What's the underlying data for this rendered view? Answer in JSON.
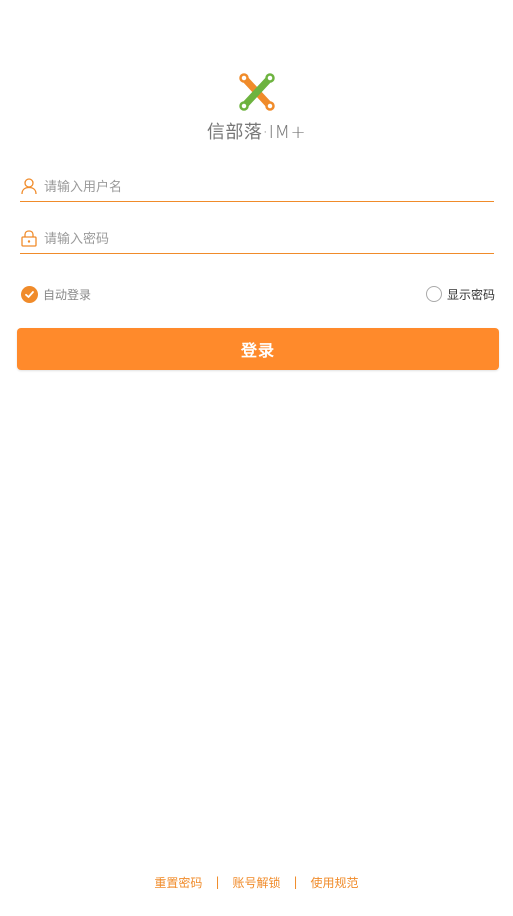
{
  "logo": {
    "name": "信部落·IM+",
    "colors": {
      "orange": "#f08b2a",
      "green": "#6db33f"
    }
  },
  "login_form": {
    "username": {
      "placeholder": "请输入用户名",
      "value": "",
      "icon": "user-icon"
    },
    "password": {
      "placeholder": "请输入密码",
      "value": "",
      "icon": "lock-icon"
    },
    "auto_login": {
      "label": "自动登录",
      "checked": true
    },
    "show_password": {
      "label": "显示密码",
      "checked": false
    },
    "submit_label": "登录"
  },
  "footer": {
    "links": [
      "重置密码",
      "账号解锁",
      "使用规范"
    ],
    "separator": "|"
  },
  "theme": {
    "accent": "#ff8a2b",
    "underline": "#f08b2a"
  }
}
